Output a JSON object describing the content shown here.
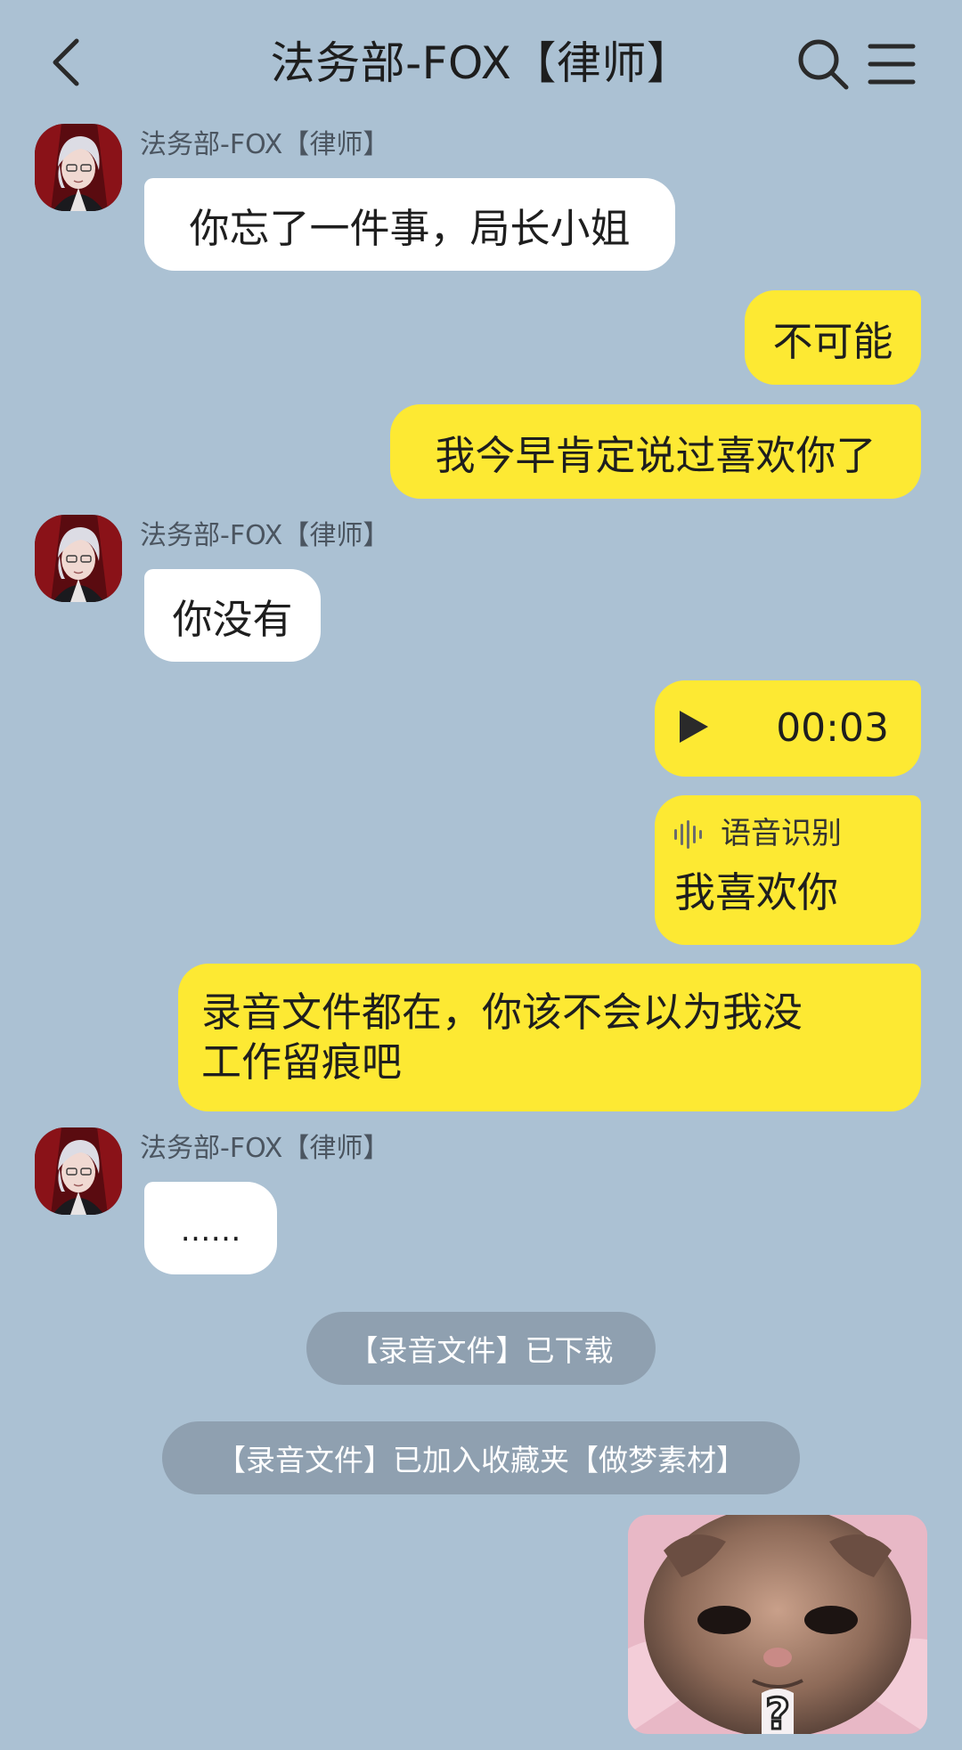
{
  "header": {
    "title": "法务部-FOX【律师】",
    "back_icon": "chevron-left-icon",
    "search_icon": "search-icon",
    "menu_icon": "hamburger-menu-icon"
  },
  "messages": [
    {
      "sender": "法务部-FOX【律师】",
      "text": "你忘了一件事，局长小姐"
    },
    {
      "text": "不可能"
    },
    {
      "text": "我今早肯定说过喜欢你了"
    },
    {
      "sender": "法务部-FOX【律师】",
      "text": "你没有"
    },
    {
      "voice_duration": "00:03",
      "icon": "play-icon"
    },
    {
      "transcription_label": "语音识别",
      "transcription_text": "我喜欢你",
      "icon": "voice-waveform-icon"
    },
    {
      "text_line1": "录音文件都在，你该不会以为我没",
      "text_line2": "工作留痕吧"
    },
    {
      "sender": "法务部-FOX【律师】",
      "text": "……"
    }
  ],
  "system_notices": [
    "【录音文件】已下载",
    "【录音文件】已加入收藏夹【做梦素材】"
  ],
  "sticker": {
    "glyph": "?"
  },
  "colors": {
    "background": "#abc1d3",
    "outgoing_bubble": "#fde933",
    "incoming_bubble": "#ffffff",
    "system_notice_bg": "#8fa0b0"
  }
}
